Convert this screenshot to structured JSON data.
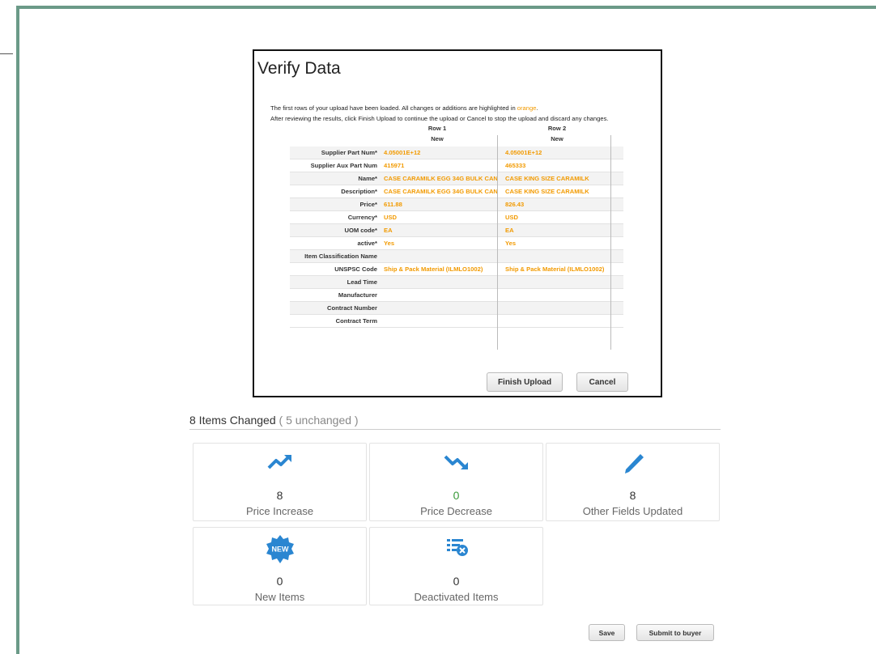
{
  "dialog": {
    "title": "Verify Data",
    "intro_line1_before": "The first rows of your upload have been loaded. All changes or additions are highlighted in ",
    "intro_line1_highlight": "orange",
    "intro_line1_after": ".",
    "intro_line2": "After reviewing the results, click Finish Upload to continue the upload or Cancel to stop the upload and discard any changes.",
    "columns": [
      {
        "row": "Row 1",
        "status": "New"
      },
      {
        "row": "Row 2",
        "status": "New"
      }
    ],
    "fields": [
      {
        "label": "Supplier Part Num*",
        "v1": "4.05001E+12",
        "v2": "4.05001E+12"
      },
      {
        "label": "Supplier Aux Part Num",
        "v1": "415971",
        "v2": "465333"
      },
      {
        "label": "Name*",
        "v1": "CASE CARAMILK EGG 34G BULK CAN",
        "v2": "CASE KING SIZE CARAMILK"
      },
      {
        "label": "Description*",
        "v1": "CASE CARAMILK EGG 34G BULK CAN",
        "v2": "CASE KING SIZE CARAMILK"
      },
      {
        "label": "Price*",
        "v1": "611.88",
        "v2": "826.43"
      },
      {
        "label": "Currency*",
        "v1": "USD",
        "v2": "USD"
      },
      {
        "label": "UOM code*",
        "v1": "EA",
        "v2": "EA"
      },
      {
        "label": "active*",
        "v1": "Yes",
        "v2": "Yes"
      },
      {
        "label": "Item Classification Name",
        "v1": "",
        "v2": ""
      },
      {
        "label": "UNSPSC Code",
        "v1": "Ship & Pack Material (ILMLO1002)",
        "v2": "Ship & Pack Material (ILMLO1002)"
      },
      {
        "label": "Lead Time",
        "v1": "",
        "v2": ""
      },
      {
        "label": "Manufacturer",
        "v1": "",
        "v2": ""
      },
      {
        "label": "Contract Number",
        "v1": "",
        "v2": ""
      },
      {
        "label": "Contract Term",
        "v1": "",
        "v2": ""
      }
    ],
    "finish_label": "Finish Upload",
    "cancel_label": "Cancel"
  },
  "summary": {
    "changed_text": "8 Items Changed",
    "unchanged_text": "( 5 unchanged )",
    "cards": [
      {
        "icon": "trend-up-icon",
        "value": "8",
        "label": "Price Increase"
      },
      {
        "icon": "trend-down-icon",
        "value": "0",
        "label": "Price Decrease"
      },
      {
        "icon": "pencil-icon",
        "value": "8",
        "label": "Other Fields Updated"
      },
      {
        "icon": "new-badge-icon",
        "value": "0",
        "label": "New Items",
        "badge_text": "NEW"
      },
      {
        "icon": "list-remove-icon",
        "value": "0",
        "label": "Deactivated Items"
      }
    ]
  },
  "footer": {
    "save_label": "Save",
    "submit_label": "Submit to buyer"
  },
  "colors": {
    "highlight": "#f29a00",
    "icon_blue": "#2a86d1",
    "frame_green": "#6b9a88",
    "value_green": "#3a9a3a"
  }
}
